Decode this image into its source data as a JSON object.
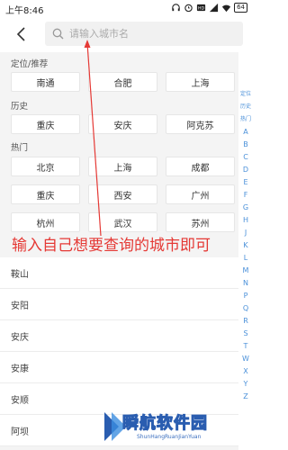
{
  "status": {
    "time": "上午8:46",
    "battery": "64"
  },
  "search": {
    "placeholder": "请输入城市名"
  },
  "sections": {
    "location": {
      "label": "定位/推荐",
      "cities": [
        "南通",
        "合肥",
        "上海"
      ]
    },
    "history": {
      "label": "历史",
      "cities": [
        "重庆",
        "安庆",
        "阿克苏"
      ]
    },
    "hot": {
      "label": "热门",
      "cities": [
        "北京",
        "上海",
        "成都",
        "重庆",
        "西安",
        "广州",
        "杭州",
        "武汉",
        "苏州"
      ]
    }
  },
  "list_items": [
    "鞍山",
    "安阳",
    "安庆",
    "安康",
    "安顺",
    "阿坝"
  ],
  "index_bar": {
    "top": [
      "定位",
      "历史",
      "热门"
    ],
    "letters": [
      "A",
      "B",
      "C",
      "D",
      "E",
      "F",
      "G",
      "H",
      "J",
      "K",
      "L",
      "M",
      "N",
      "P",
      "Q",
      "R",
      "S",
      "T",
      "W",
      "X",
      "Y",
      "Z"
    ]
  },
  "annotation": {
    "text": "输入自己想要查询的城市即可",
    "color": "#e53935"
  },
  "watermark": {
    "main": "瞬航软件园",
    "sub": "ShunHangRuanJianYuan"
  },
  "colors": {
    "accent": "#4a90d9",
    "annotation": "#e53935"
  }
}
